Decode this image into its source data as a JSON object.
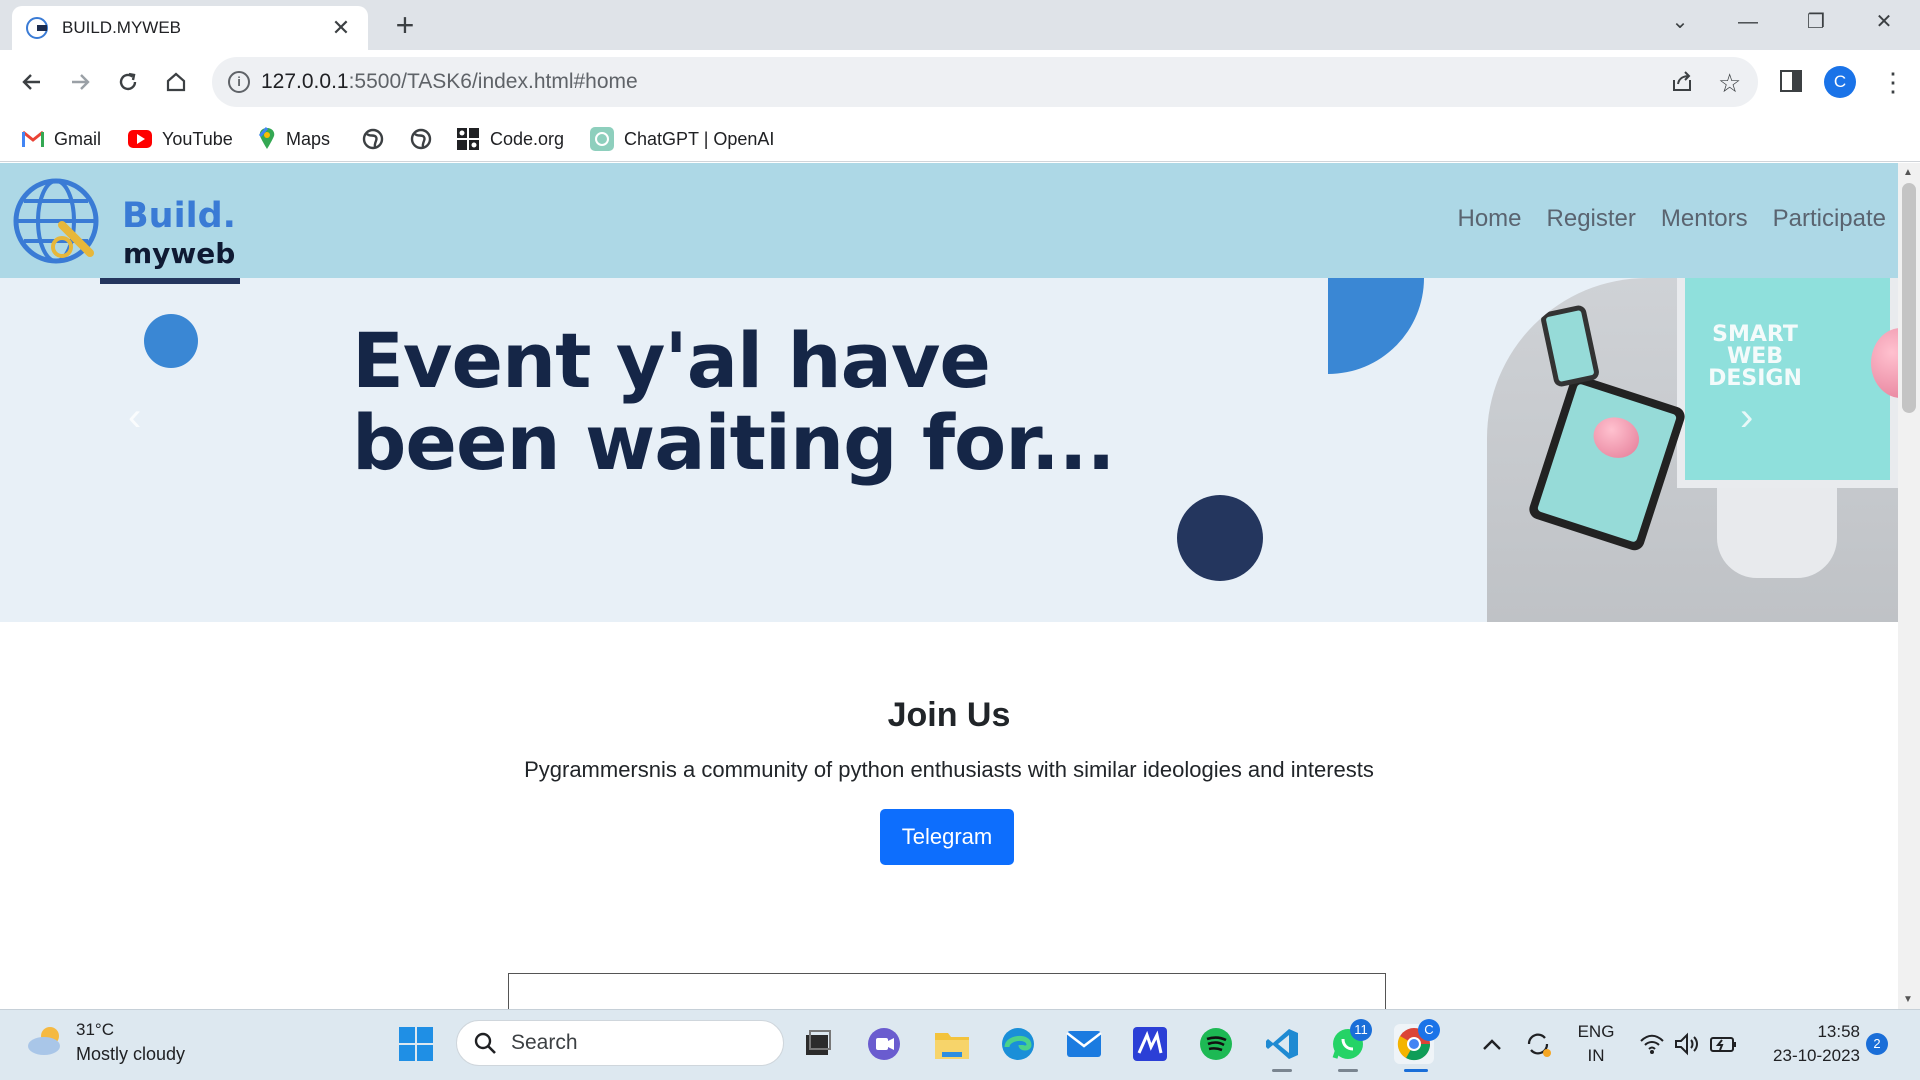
{
  "browser": {
    "tab_title": "BUILD.MYWEB",
    "url_host": "127.0.0.1",
    "url_rest": ":5500/TASK6/index.html#home",
    "profile_initial": "C",
    "bookmarks": [
      {
        "label": "Gmail",
        "icon": "gmail-icon"
      },
      {
        "label": "YouTube",
        "icon": "youtube-icon"
      },
      {
        "label": "Maps",
        "icon": "maps-icon"
      },
      {
        "label": "",
        "icon": "globe-icon"
      },
      {
        "label": "",
        "icon": "globe-icon"
      },
      {
        "label": "Code.org",
        "icon": "code-org-icon"
      },
      {
        "label": "ChatGPT | OpenAI",
        "icon": "openai-icon"
      }
    ]
  },
  "site": {
    "logo_line1": "Build.",
    "logo_line2": "myweb",
    "nav": [
      "Home",
      "Register",
      "Mentors",
      "Participate"
    ],
    "hero": {
      "headline_line1": "Event y'al have",
      "headline_line2": "been waiting for...",
      "device_text": "SMART WEB DESIGN"
    },
    "join": {
      "title": "Join Us",
      "description": "Pygrammersnis a community of python enthusiasts with similar ideologies and interests",
      "button": "Telegram"
    }
  },
  "taskbar": {
    "weather_temp": "31°C",
    "weather_desc": "Mostly cloudy",
    "search_label": "Search",
    "whatsapp_badge": "11",
    "chrome_badge": "C",
    "lang_line1": "ENG",
    "lang_line2": "IN",
    "time": "13:58",
    "date": "23-10-2023",
    "notification_count": "2"
  },
  "colors": {
    "nav_bg": "#add8e6",
    "hero_bg": "#e8f0f7",
    "accent_blue": "#3a87d4",
    "navy": "#24365e",
    "button_blue": "#0d6efd"
  }
}
